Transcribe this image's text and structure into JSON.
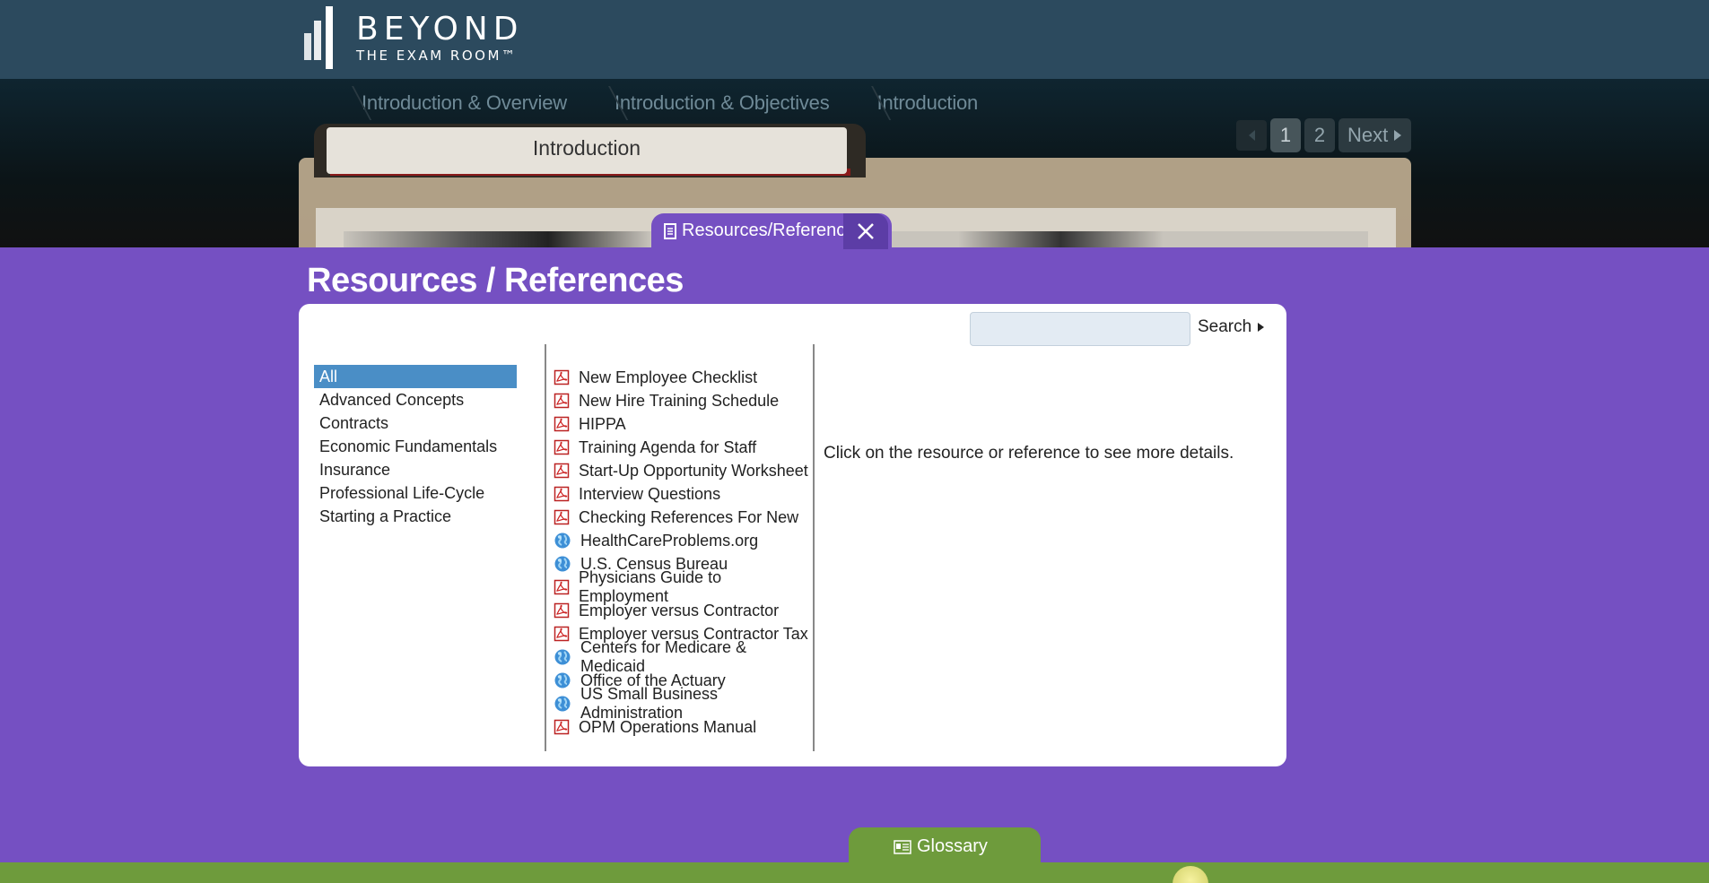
{
  "header": {
    "brand": "BEYOND",
    "tagline": "THE EXAM ROOM™"
  },
  "breadcrumbs": [
    "Introduction & Overview",
    "Introduction & Objectives",
    "Introduction"
  ],
  "pager": {
    "pages": [
      "1",
      "2"
    ],
    "current": "1",
    "next_label": "Next"
  },
  "lesson_tab": {
    "title": "Introduction"
  },
  "resources_tab": {
    "label": "Resources/References"
  },
  "panel": {
    "title": "Resources / References",
    "search_placeholder": "",
    "search_label": "Search",
    "details_hint": "Click on the resource or reference to see more details."
  },
  "categories": [
    {
      "label": "All",
      "selected": true
    },
    {
      "label": "Advanced Concepts"
    },
    {
      "label": "Contracts"
    },
    {
      "label": "Economic Fundamentals"
    },
    {
      "label": "Insurance"
    },
    {
      "label": "Professional Life-Cycle"
    },
    {
      "label": "Starting a Practice"
    }
  ],
  "resources": [
    {
      "label": "New Employee Checklist",
      "icon": "pdf-icon"
    },
    {
      "label": "New Hire Training Schedule",
      "icon": "pdf-icon"
    },
    {
      "label": "HIPPA",
      "icon": "pdf-icon"
    },
    {
      "label": "Training Agenda for Staff",
      "icon": "pdf-icon"
    },
    {
      "label": "Start-Up Opportunity Worksheet",
      "icon": "pdf-icon"
    },
    {
      "label": "Interview Questions",
      "icon": "pdf-icon"
    },
    {
      "label": "Checking References For New",
      "icon": "pdf-icon"
    },
    {
      "label": "HealthCareProblems.org",
      "icon": "globe-icon"
    },
    {
      "label": "U.S. Census Bureau",
      "icon": "globe-icon"
    },
    {
      "label": "Physicians Guide to Employment",
      "icon": "pdf-icon"
    },
    {
      "label": "Employer versus Contractor",
      "icon": "pdf-icon"
    },
    {
      "label": "Employer versus Contractor Tax",
      "icon": "pdf-icon"
    },
    {
      "label": "Centers for Medicare & Medicaid",
      "icon": "globe-icon"
    },
    {
      "label": "Office of the Actuary",
      "icon": "globe-icon"
    },
    {
      "label": "US Small Business Administration",
      "icon": "globe-icon"
    },
    {
      "label": "OPM Operations Manual",
      "icon": "pdf-icon"
    }
  ],
  "glossary_tab": {
    "label": "Glossary"
  },
  "colors": {
    "header": "#2c4a5e",
    "panel": "#7550c2",
    "selected": "#4a8ec6",
    "glossary": "#6e9b3c"
  }
}
